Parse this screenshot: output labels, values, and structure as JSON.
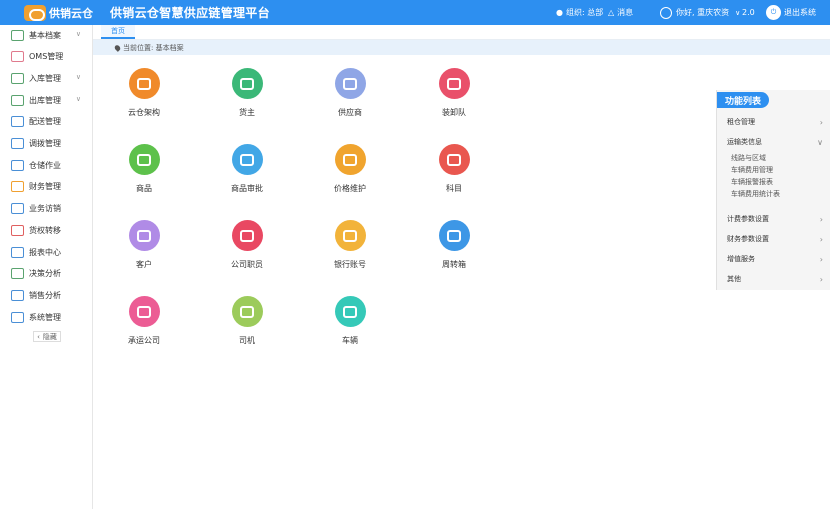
{
  "header": {
    "logo_text": "供销云仓",
    "title": "供销云仓智慧供应链管理平台",
    "org_label": "组织: 总部",
    "messages_label": "消息",
    "greeting": "你好, 重庆农资",
    "version": "2.0",
    "logout_label": "退出系统"
  },
  "sidebar": {
    "items": [
      {
        "label": "基本档案",
        "has_arrow": true
      },
      {
        "label": "OMS管理",
        "has_arrow": false
      },
      {
        "label": "入库管理",
        "has_arrow": true
      },
      {
        "label": "出库管理",
        "has_arrow": true
      },
      {
        "label": "配送管理",
        "has_arrow": false
      },
      {
        "label": "调拨管理",
        "has_arrow": false
      },
      {
        "label": "仓储作业",
        "has_arrow": false
      },
      {
        "label": "财务管理",
        "has_arrow": false
      },
      {
        "label": "业务访销",
        "has_arrow": false
      },
      {
        "label": "货权转移",
        "has_arrow": false
      },
      {
        "label": "报表中心",
        "has_arrow": false
      },
      {
        "label": "决策分析",
        "has_arrow": false
      },
      {
        "label": "销售分析",
        "has_arrow": false
      },
      {
        "label": "系统管理",
        "has_arrow": false
      }
    ],
    "hide_label": "隐藏"
  },
  "tabs": {
    "home": "首页"
  },
  "breadcrumb": "当前位置: 基本档案",
  "grid": [
    {
      "label": "云仓架构",
      "icon": "org-chart-icon",
      "color": "#f08a2b"
    },
    {
      "label": "货主",
      "icon": "owner-icon",
      "color": "#3bb878"
    },
    {
      "label": "供应商",
      "icon": "badge-icon",
      "color": "#8fa6e6"
    },
    {
      "label": "装卸队",
      "icon": "cart-icon",
      "color": "#e9506a"
    },
    {
      "label": "商品",
      "icon": "box-icon",
      "color": "#5dc14b"
    },
    {
      "label": "商品审批",
      "icon": "approval-icon",
      "color": "#42a7e6"
    },
    {
      "label": "价格维护",
      "icon": "price-tag-icon",
      "color": "#f0a42e"
    },
    {
      "label": "科目",
      "icon": "book-icon",
      "color": "#e9574f"
    },
    {
      "label": "客户",
      "icon": "customer-icon",
      "color": "#b08be6"
    },
    {
      "label": "公司职员",
      "icon": "staff-icon",
      "color": "#e94862"
    },
    {
      "label": "银行账号",
      "icon": "bank-card-icon",
      "color": "#f2b33a"
    },
    {
      "label": "周转箱",
      "icon": "crate-icon",
      "color": "#3d97e6"
    },
    {
      "label": "承运公司",
      "icon": "carrier-icon",
      "color": "#ec5c94"
    },
    {
      "label": "司机",
      "icon": "driver-icon",
      "color": "#9ccb5b"
    },
    {
      "label": "车辆",
      "icon": "truck-icon",
      "color": "#35c9b8"
    }
  ],
  "function_panel": {
    "title": "功能列表",
    "rows": [
      {
        "label": "租仓管理",
        "arrow": "right"
      },
      {
        "label": "运输类信息",
        "arrow": "down"
      },
      {
        "label": "计费参数设置",
        "arrow": "right"
      },
      {
        "label": "财务参数设置",
        "arrow": "right"
      },
      {
        "label": "增值服务",
        "arrow": "right"
      },
      {
        "label": "其他",
        "arrow": "right"
      }
    ],
    "sub_items": [
      "线路与区域",
      "车辆费用管理",
      "车辆报警报表",
      "车辆费用统计表"
    ]
  }
}
